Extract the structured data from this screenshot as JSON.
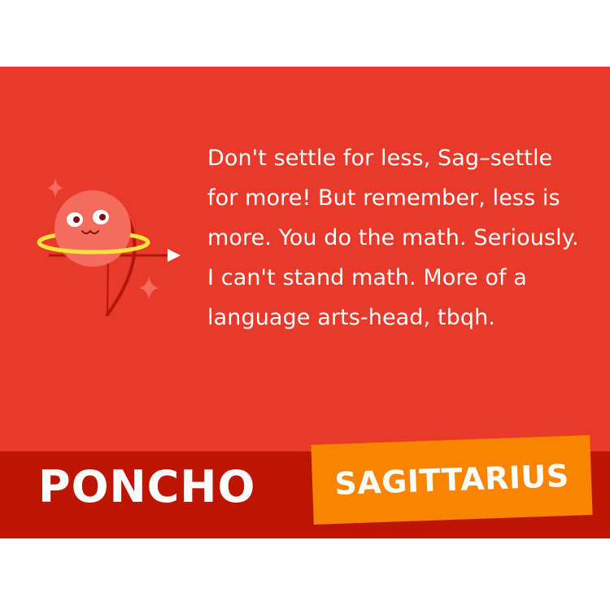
{
  "card": {
    "horoscope_text": "Don't settle for less, Sag–settle for more! But remember, less is more. You do the math. Seriously. I can't stand math. More of a language arts-head, tbqh.",
    "brand": "PONCHO",
    "sign": "SAGITTARIUS"
  },
  "colors": {
    "card_background": "#e8392a",
    "footer_band": "#bd1502",
    "sign_badge": "#f88400",
    "planet": "#f56c5e",
    "ring": "#f7e43a",
    "bow": "#b3160b",
    "text": "#ffffff"
  },
  "icons": [
    "planet-mascot-icon",
    "bow-and-arrow-icon",
    "sparkle-icon"
  ]
}
